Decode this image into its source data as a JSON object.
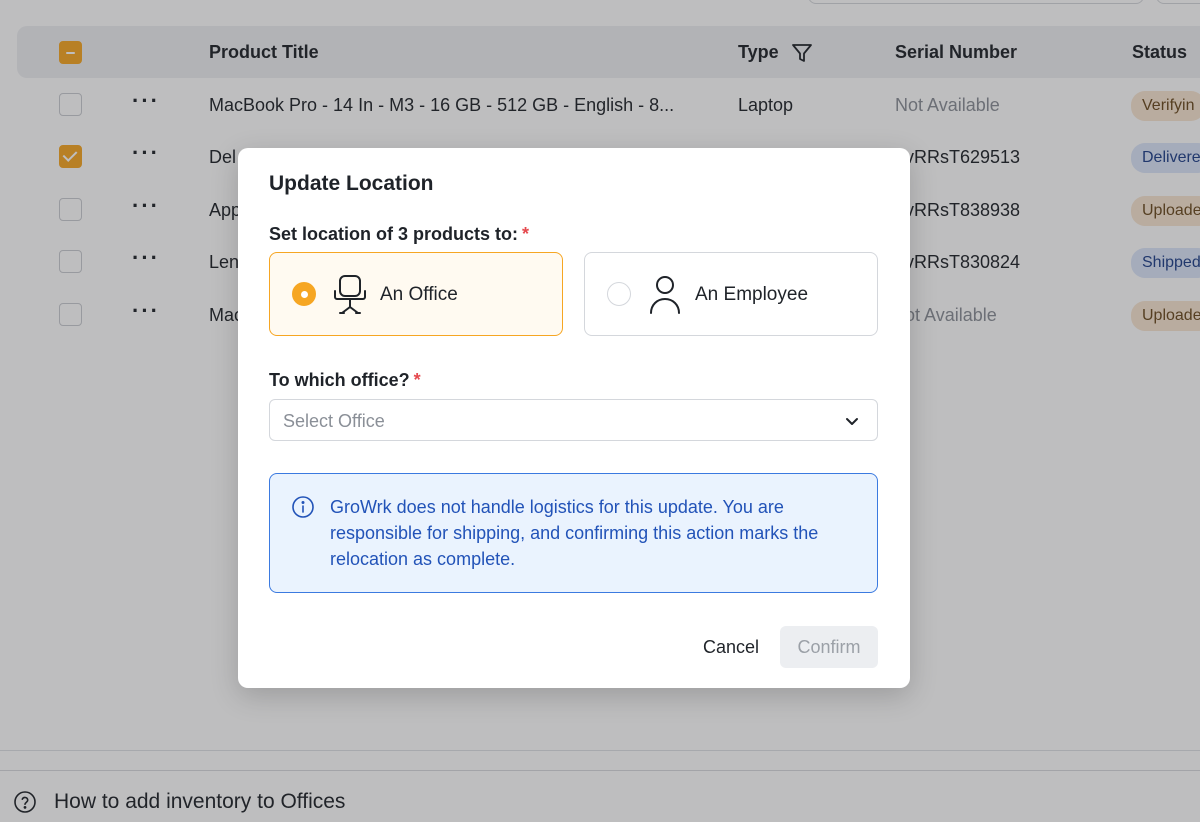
{
  "table": {
    "headers": {
      "product_title": "Product Title",
      "type": "Type",
      "serial_number": "Serial Number",
      "status": "Status"
    },
    "rows": [
      {
        "checked": false,
        "title": "MacBook Pro - 14 In - M3 - 16 GB - 512 GB - English - 8...",
        "type": "Laptop",
        "serial": "Not Available",
        "serial_muted": true,
        "status": "Verifyin",
        "status_tone": "warm"
      },
      {
        "checked": true,
        "title": "Del",
        "type": "",
        "serial": "vRRsT629513",
        "serial_muted": false,
        "status": "Delivere",
        "status_tone": "blue"
      },
      {
        "checked": false,
        "title": "App",
        "type": "",
        "serial": "vRRsT838938",
        "serial_muted": false,
        "status": "Uploade",
        "status_tone": "warm"
      },
      {
        "checked": false,
        "title": "Len",
        "type": "",
        "serial": "vRRsT830824",
        "serial_muted": false,
        "status": "Shipped",
        "status_tone": "blue"
      },
      {
        "checked": false,
        "title": "Mac",
        "type": "",
        "serial": "ot Available",
        "serial_muted": true,
        "status": "Uploade",
        "status_tone": "warm"
      }
    ]
  },
  "footer": {
    "help_text": "How to add inventory to Offices"
  },
  "modal": {
    "title": "Update Location",
    "set_location_label": "Set location of 3 products to:",
    "required_mark": "*",
    "options": [
      {
        "label": "An Office",
        "icon": "office-chair-icon",
        "selected": true
      },
      {
        "label": "An Employee",
        "icon": "person-icon",
        "selected": false
      }
    ],
    "office_label": "To which office?",
    "office_select": {
      "placeholder": "Select Office"
    },
    "info": "GroWrk does not handle logistics for this update. You are responsible for shipping, and confirming this action marks the relocation as complete.",
    "cancel_label": "Cancel",
    "confirm_label": "Confirm"
  },
  "colors": {
    "accent": "#f6a623",
    "info_blue": "#2253b8",
    "required_red": "#e5484d"
  }
}
